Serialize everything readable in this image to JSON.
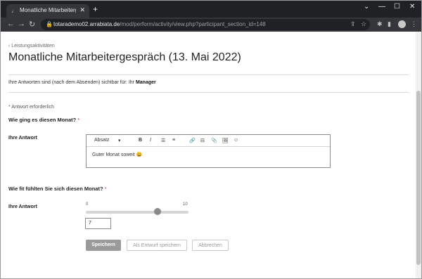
{
  "browser": {
    "tab_title": "Monatliche Mitarbeitergespräch",
    "tab_favicon": "♩",
    "tab_close": "✕",
    "new_tab": "+",
    "window_controls": [
      "⌄",
      "—",
      "☐",
      "✕"
    ],
    "url_host": "totarademo02.arrabiata.de",
    "url_path": "/mod/perform/activity/view.php?participant_section_id=148",
    "nav_icons": [
      "←",
      "→",
      "↻"
    ]
  },
  "page": {
    "back_link": "‹  Leistungsaktivitäten",
    "title": "Monatliche Mitarbeitergespräch (13. Mai 2022)",
    "visibility_prefix": "Ihre Antworten sind (nach dem Absenden) sichtbar für: Ihr ",
    "visibility_role": "Manager",
    "required_note": "* Antwort erforderlich"
  },
  "question1": {
    "text": "Wie ging es diesen Monat? ",
    "star": "*",
    "answer_label": "Ihre Antwort",
    "editor": {
      "format_select": "Absatz",
      "format_caret": "▾",
      "bold": "B",
      "italic": "I",
      "bullet_list": "☰",
      "numbered_list": "≡",
      "link": "🔗",
      "table": "⊟",
      "attach": "📎",
      "image": "🖼",
      "emoji": "☺",
      "content": "Guter Monat soweit 😀"
    }
  },
  "question2": {
    "text": "Wie fit fühlten Sie sich diesen Monat? ",
    "star": "*",
    "answer_label": "Ihre Antwort",
    "slider": {
      "min": "0",
      "max": "10",
      "value": 7
    },
    "number_value": "7"
  },
  "actions": {
    "save": "Speichern",
    "save_draft": "Als Entwurf speichern",
    "cancel": "Abbrechen"
  }
}
